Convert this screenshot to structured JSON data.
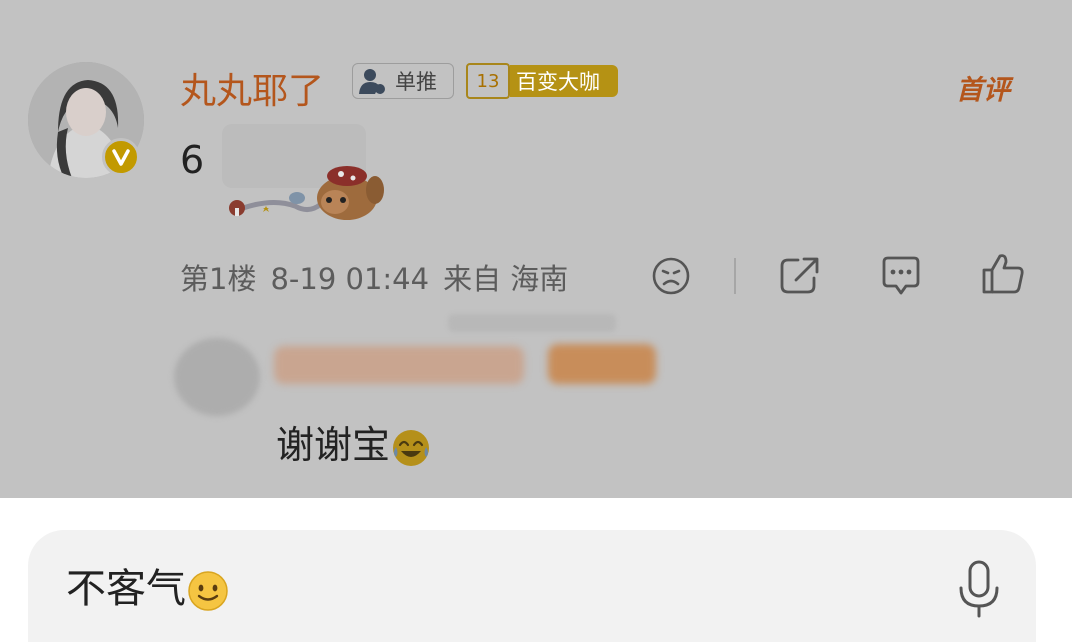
{
  "comment": {
    "username": "丸丸耶了",
    "tag_single": "单推",
    "level_number": "13",
    "tag_title": "百变大咖",
    "first_comment_badge": "首评",
    "text": "6",
    "meta": {
      "floor": "第1楼",
      "time": "8-19 01:44",
      "source": "来自 海南"
    }
  },
  "reply": {
    "text": "谢谢宝"
  },
  "input": {
    "text": "不客气"
  },
  "colors": {
    "accent": "#b4561c",
    "badge_gold": "#b59214",
    "overlay": "#c2c2c2"
  },
  "icons": [
    "dislike-icon",
    "share-icon",
    "comment-icon",
    "like-icon",
    "mic-icon"
  ]
}
